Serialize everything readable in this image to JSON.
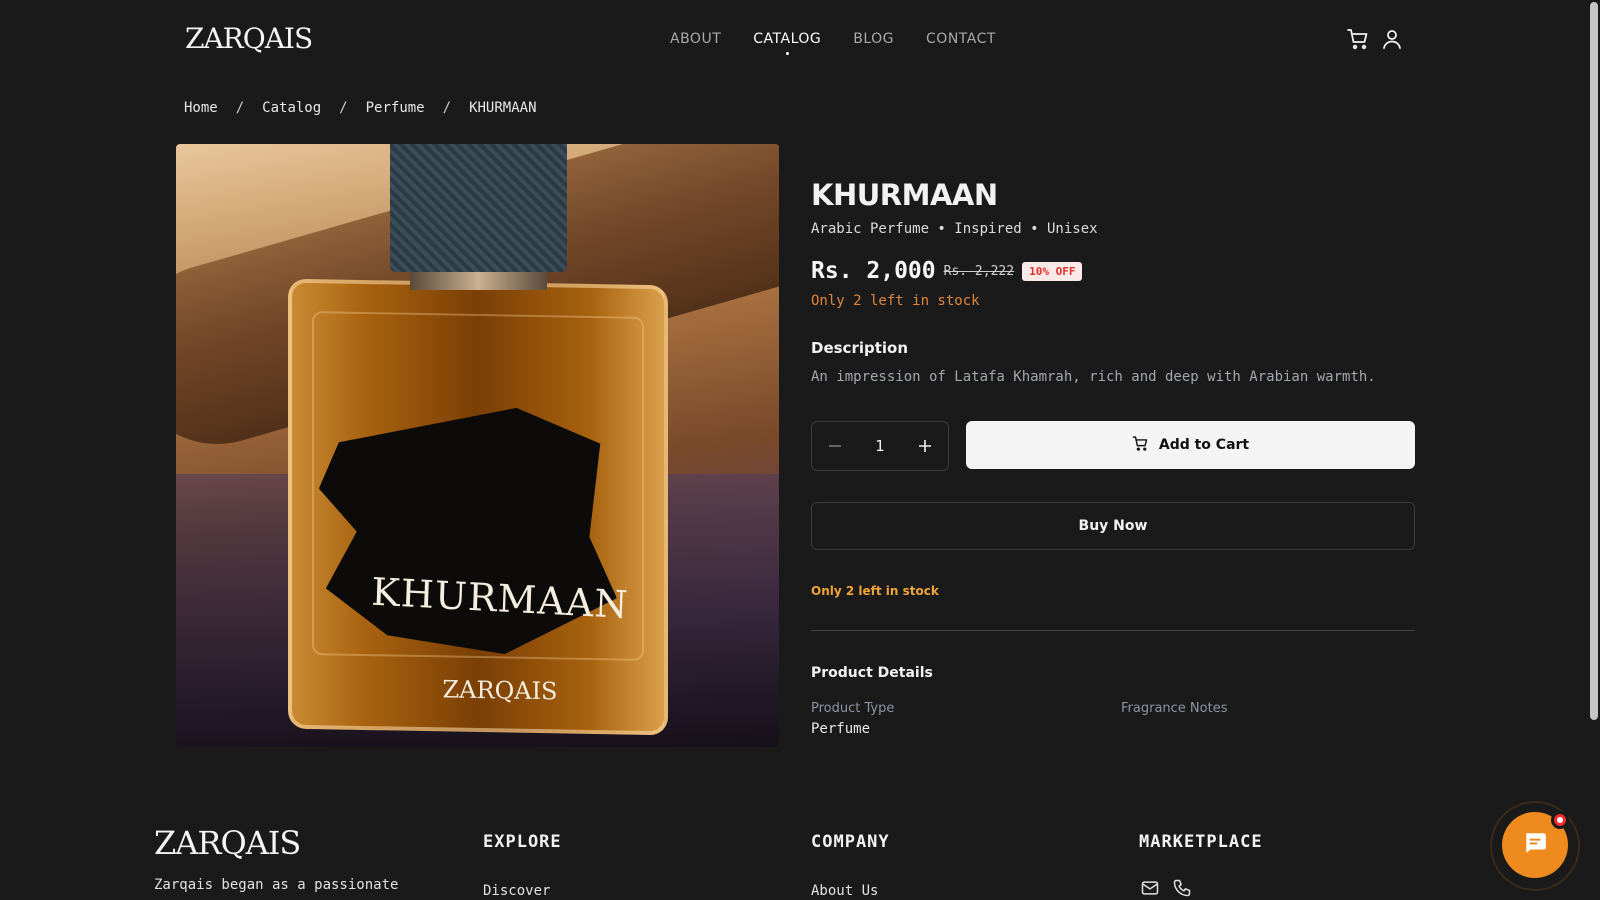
{
  "brand": {
    "logo": "ZARQAIS"
  },
  "nav": {
    "items": [
      {
        "label": "ABOUT",
        "active": false
      },
      {
        "label": "CATALOG",
        "active": true
      },
      {
        "label": "BLOG",
        "active": false
      },
      {
        "label": "CONTACT",
        "active": false
      }
    ],
    "icons": [
      "cart-icon",
      "user-icon"
    ]
  },
  "breadcrumb": {
    "items": [
      "Home",
      "Catalog",
      "Perfume",
      "KHURMAAN"
    ],
    "separator": "/"
  },
  "product": {
    "image": {
      "bottle_name": "KHURMAAN",
      "bottle_brand": "ZARQAIS"
    },
    "title": "KHURMAAN",
    "subtitle": "Arabic Perfume • Inspired • Unisex",
    "price": "Rs. 2,000",
    "old_price": "Rs. 2,222",
    "discount": "10% OFF",
    "stock_note": "Only 2 left in stock",
    "description_heading": "Description",
    "description": "An impression of Latafa Khamrah, rich and deep with Arabian warmth.",
    "quantity": "1",
    "add_to_cart_label": "Add to Cart",
    "buy_now_label": "Buy Now",
    "stock_note_secondary": "Only 2 left in stock",
    "details_heading": "Product Details",
    "details": {
      "product_type_label": "Product Type",
      "product_type_value": "Perfume",
      "fragrance_notes_label": "Fragrance Notes"
    }
  },
  "footer": {
    "logo": "ZARQAIS",
    "about_text": "Zarqais began as a passionate",
    "columns": [
      {
        "heading": "EXPLORE",
        "first_link": "Discover"
      },
      {
        "heading": "COMPANY",
        "first_link": "About Us"
      },
      {
        "heading": "MARKETPLACE",
        "icons": [
          "mail-icon",
          "phone-icon"
        ]
      }
    ]
  },
  "colors": {
    "background": "#1a1a1a",
    "accent_orange": "#ef8a1f",
    "stock_orange": "#e0863f",
    "discount_red": "#e0322d"
  }
}
